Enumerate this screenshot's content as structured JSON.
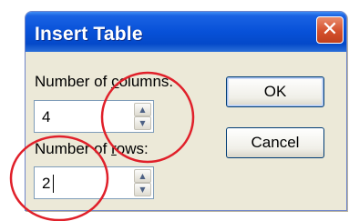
{
  "dialog": {
    "title": "Insert Table",
    "close_glyph": "✕",
    "columns": {
      "label_pre": "Number of ",
      "label_accel": "c",
      "label_post": "olumns:",
      "value": "4"
    },
    "rows": {
      "label_pre": "Number of ",
      "label_accel": "r",
      "label_post": "ows:",
      "value": "2"
    },
    "ok_label": "OK",
    "cancel_label": "Cancel"
  },
  "icons": {
    "spin_up": "▲",
    "spin_down": "▼",
    "close": "close-icon"
  },
  "colors": {
    "title_bar": "#0751d8",
    "dialog_bg": "#ece9d8",
    "annotation_circle": "#e0202a",
    "close_button": "#d4502c"
  }
}
